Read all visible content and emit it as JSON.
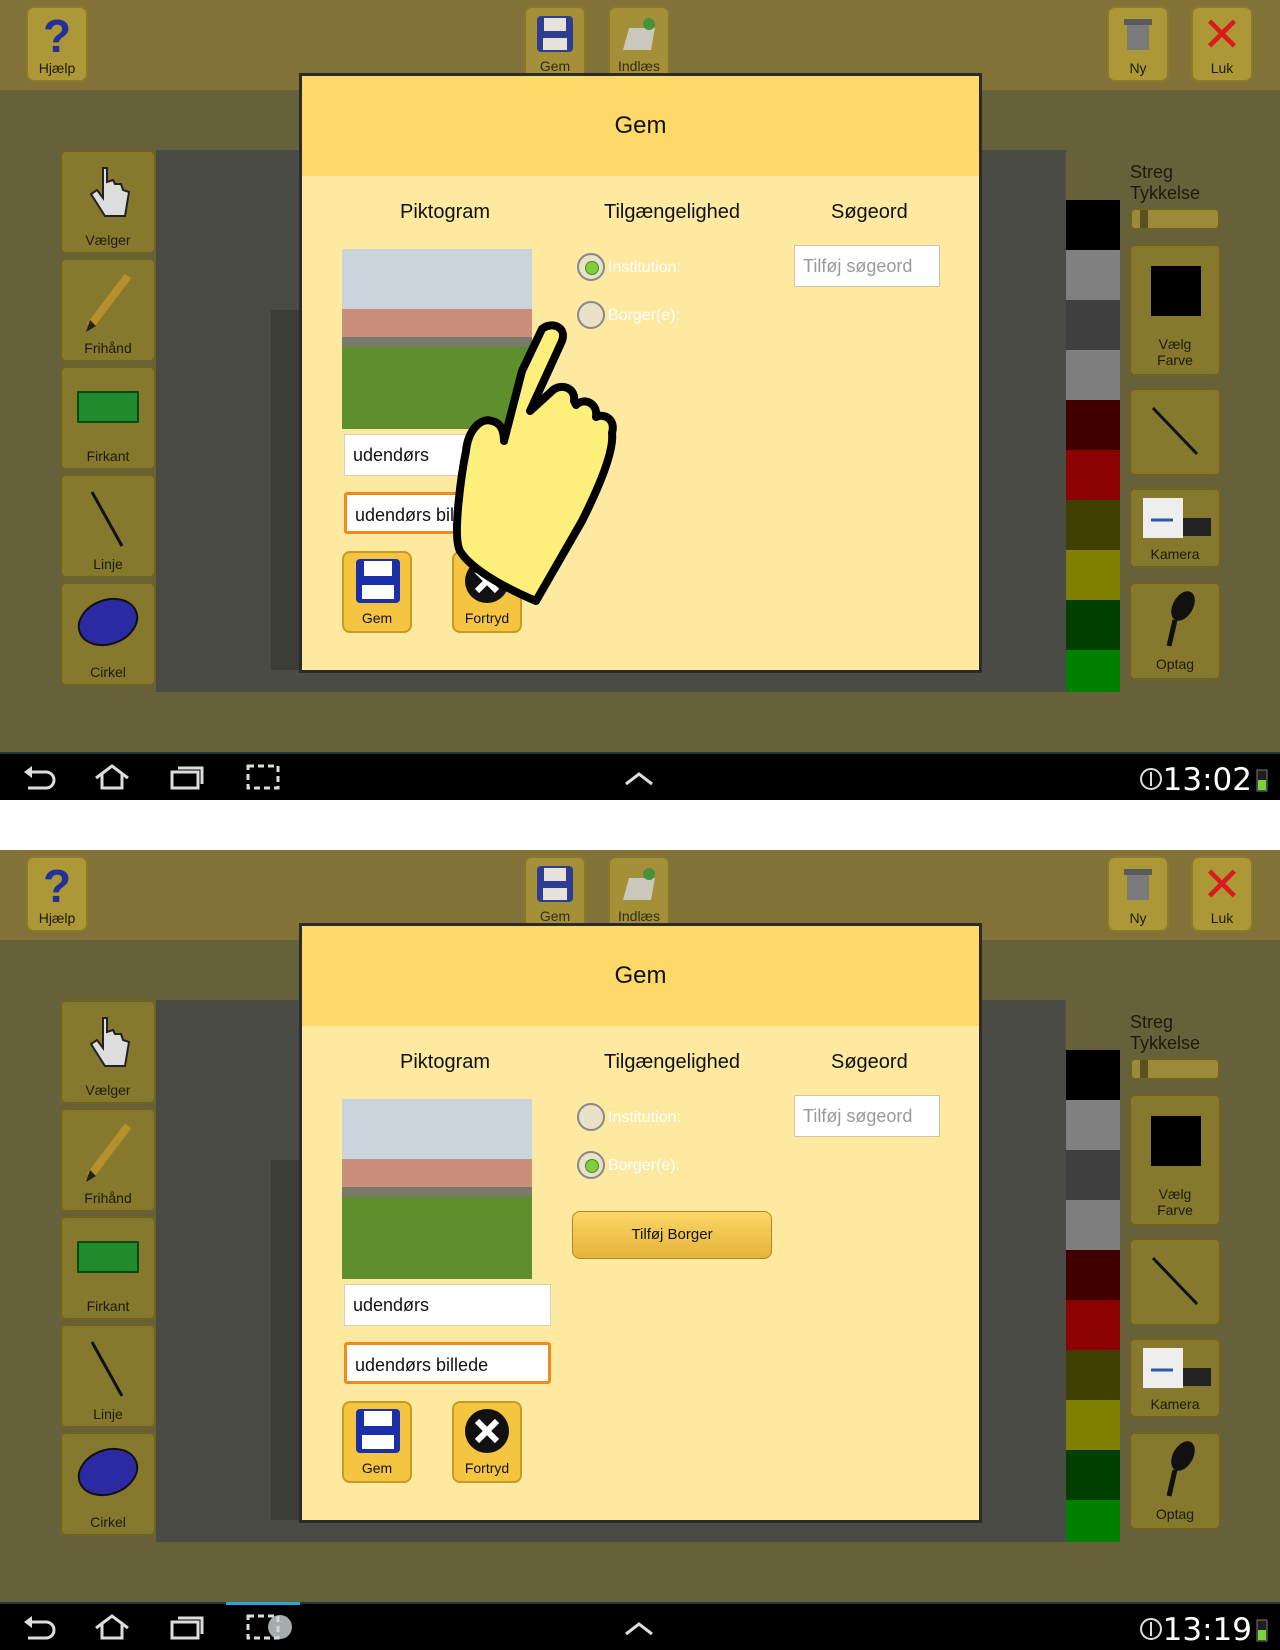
{
  "toolbar": {
    "help": "Hjælp",
    "save": "Gem",
    "load": "Indlæs",
    "new": "Ny",
    "close": "Luk"
  },
  "tools": {
    "select": "Vælger",
    "freehand": "Frihånd",
    "rect": "Firkant",
    "line": "Linje",
    "circle": "Cirkel"
  },
  "right": {
    "stroke_line1": "Streg",
    "stroke_line2": "Tykkelse",
    "choose_color_line1": "Vælg",
    "choose_color_line2": "Farve",
    "camera": "Kamera",
    "record": "Optag"
  },
  "palette": [
    "#000000",
    "#808080",
    "#3f3f3f",
    "#7f7f7f",
    "#400000",
    "#8b0000",
    "#3f3f00",
    "#7f7f00",
    "#003f00",
    "#008000"
  ],
  "dialog": {
    "title": "Gem",
    "col_pictogram": "Piktogram",
    "col_access": "Tilgængelighed",
    "col_keyword": "Søgeord",
    "radio_institution": "Institution:",
    "radio_citizen": "Borger(e):",
    "keyword_placeholder": "Tilføj søgeord",
    "save_label": "Gem",
    "cancel_label": "Fortryd",
    "add_citizen": "Tilføj Borger"
  },
  "screen1": {
    "name_value": "udendørs",
    "desc_value": "udendørs bill",
    "time": "13:02"
  },
  "screen2": {
    "name_value": "udendørs",
    "desc_value": "udendørs billede",
    "time": "13:19"
  }
}
